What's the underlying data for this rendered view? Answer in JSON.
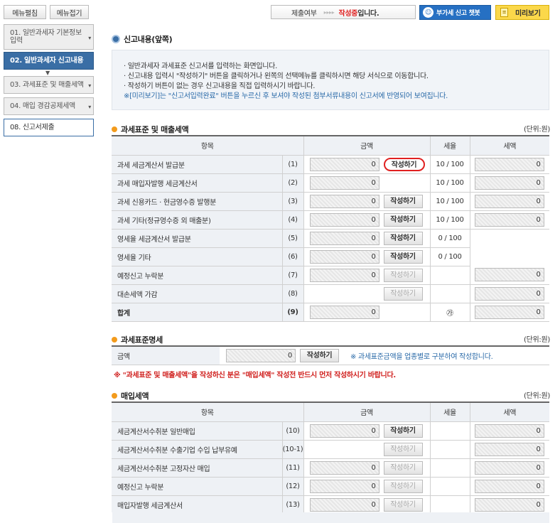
{
  "sidebar": {
    "edit": "메뉴펼침",
    "collapse": "메뉴접기",
    "items": [
      "01. 일반과세자 기본정보 입력",
      "02. 일반과세자 신고내용",
      "03. 과세표준 및 매출세액",
      "04. 매입 경감공제세액",
      "08. 신고서제출"
    ]
  },
  "topbar": {
    "status_label": "제출여부",
    "status_arrows": "▸▸▸▸",
    "status_value": "작성중",
    "status_suffix": "입니다.",
    "chatbot": "부가세 신고 챗봇",
    "preview": "미리보기"
  },
  "header": {
    "title": "신고내용(앞쪽)"
  },
  "info": {
    "lines": [
      "일반과세자 과세표준 신고서를 입력하는 화면입니다.",
      "신고내용 입력시 \"작성하기\" 버튼을 클릭하거나 왼쪽의 선택메뉴를 클릭하시면 해당 서식으로 이동합니다.",
      "작성하기 버튼이 없는 경우 신고내용을 직접 입력하시기 바랍니다."
    ],
    "note": "※[미리보기]는 \"신고서입력완료\" 버튼을 누르신 후 보셔야 작성된 첨부서류내용이 신고서에 반영되어 보여집니다."
  },
  "sales": {
    "title": "과세표준 및 매출세액",
    "unit": "(단위:원)",
    "headers": [
      "항목",
      "금액",
      "세율",
      "세액"
    ],
    "rows": [
      {
        "label": "과세 세금계산서 발급분",
        "no": "(1)",
        "amount": "0",
        "btn": "작성하기",
        "rate": "10 / 100",
        "tax": "0"
      },
      {
        "label": "과세 매입자발행 세금계산서",
        "no": "(2)",
        "amount": "0",
        "btn": "",
        "rate": "10 / 100",
        "tax": "0"
      },
      {
        "label": "과세 신용카드 · 현금영수증 발행분",
        "no": "(3)",
        "amount": "0",
        "btn": "작성하기",
        "rate": "10 / 100",
        "tax": "0"
      },
      {
        "label": "과세 기타(정규영수증 외 매출분)",
        "no": "(4)",
        "amount": "0",
        "btn": "작성하기",
        "rate": "10 / 100",
        "tax": "0"
      },
      {
        "label": "영세율 세금계산서 발급분",
        "no": "(5)",
        "amount": "0",
        "btn": "작성하기",
        "rate": "0 / 100",
        "tax": ""
      },
      {
        "label": "영세율 기타",
        "no": "(6)",
        "amount": "0",
        "btn": "작성하기",
        "rate": "0 / 100",
        "tax": ""
      },
      {
        "label": "예정신고 누락분",
        "no": "(7)",
        "amount": "0",
        "btn": "작성하기",
        "rate": "",
        "tax": "0"
      },
      {
        "label": "대손세액 가감",
        "no": "(8)",
        "amount": "",
        "btn": "작성하기",
        "rate": "",
        "tax": "0"
      },
      {
        "label": "합계",
        "no": "(9)",
        "amount": "0",
        "btn": "",
        "rate": "㉮",
        "tax": "0"
      }
    ]
  },
  "base": {
    "title": "과세표준명세",
    "unit": "(단위:원)",
    "label": "금액",
    "amount": "0",
    "btn": "작성하기",
    "note": "※ 과세표준금액을 업종별로 구분하여 작성합니다."
  },
  "warning": "※ \"과세표준 및 매출세액\"을 작성하신 분은 \"매입세액\" 작성전 반드시 먼저 작성하시기 바랍니다.",
  "purchase": {
    "title": "매입세액",
    "unit": "(단위:원)",
    "headers": [
      "항목",
      "금액",
      "세율",
      "세액"
    ],
    "rows": [
      {
        "label": "세금계산서수취분 일반매입",
        "no": "(10)",
        "amount": "0",
        "btn": "작성하기",
        "tax": "0"
      },
      {
        "label": "세금계산서수취분 수출기업 수입 납부유예",
        "no": "(10-1)",
        "amount": "",
        "btn": "작성하기",
        "tax": "0"
      },
      {
        "label": "세금계산서수취분 고정자산 매입",
        "no": "(11)",
        "amount": "0",
        "btn": "작성하기",
        "tax": "0"
      },
      {
        "label": "예정신고 누락분",
        "no": "(12)",
        "amount": "0",
        "btn": "작성하기",
        "tax": "0"
      },
      {
        "label": "매입자발행 세금계산서",
        "no": "(13)",
        "amount": "0",
        "btn": "작성하기",
        "tax": "0"
      }
    ]
  }
}
